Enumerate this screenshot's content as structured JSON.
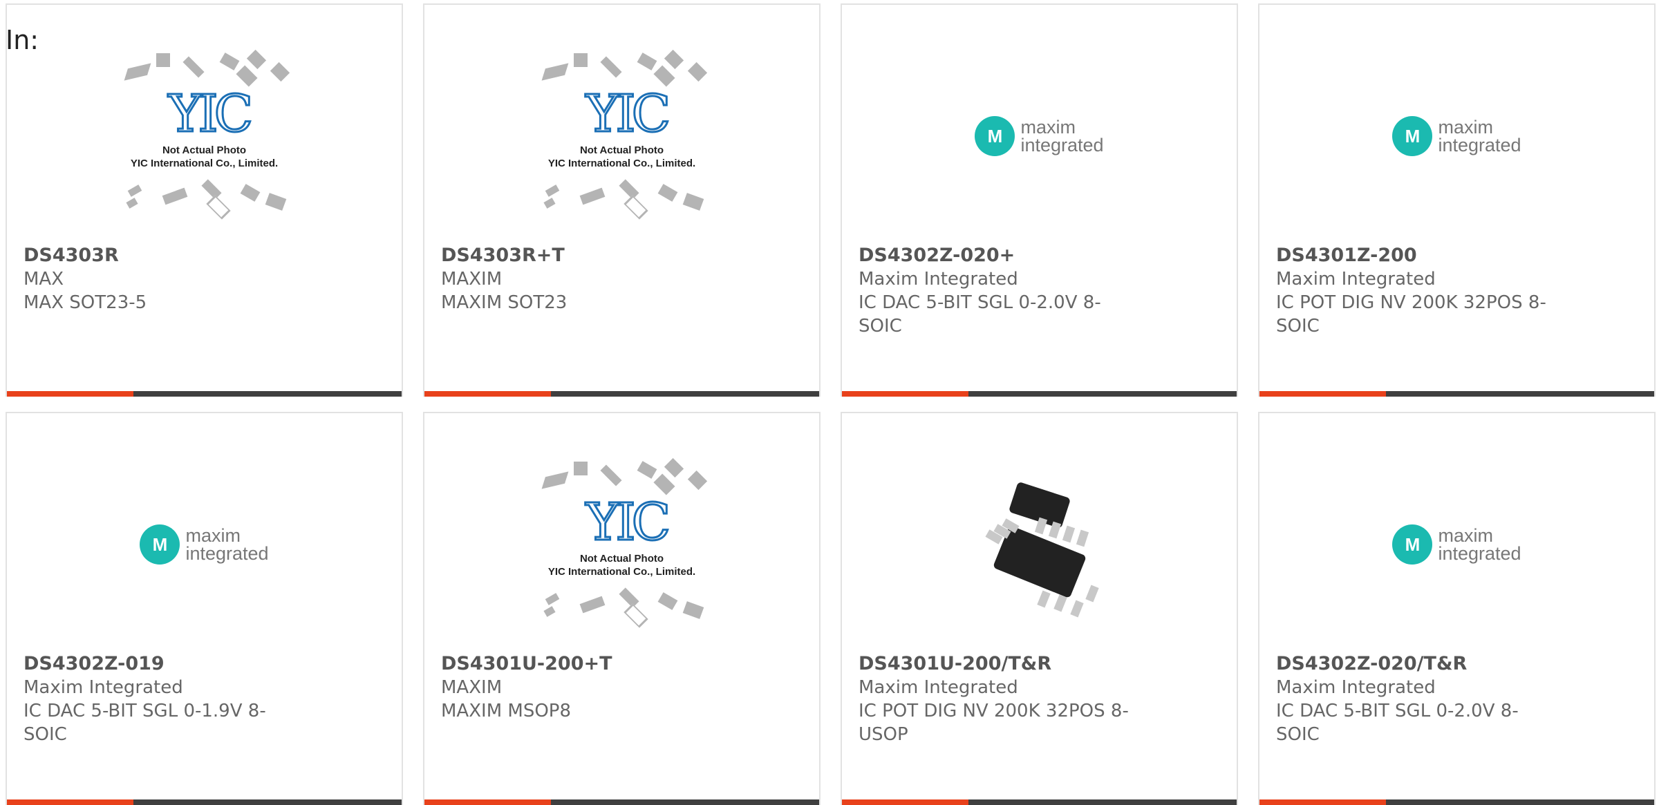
{
  "page": {
    "in_label": "In:"
  },
  "colors": {
    "accent": "#e8411b",
    "bar": "#3f3f3f",
    "maxim_teal": "#1bbab0",
    "yic_blue": "#1b6fb5"
  },
  "placeholder": {
    "logo": "YIC",
    "line1": "Not Actual Photo",
    "line2": "YIC International Co., Limited."
  },
  "maxim_logo": {
    "mark": "M",
    "line1": "maxim",
    "line2": "integrated"
  },
  "products": [
    {
      "part": "DS4303R",
      "mfr": "MAX",
      "desc": "MAX SOT23-5",
      "image": "yic-placeholder"
    },
    {
      "part": "DS4303R+T",
      "mfr": "MAXIM",
      "desc": "MAXIM SOT23",
      "image": "yic-placeholder"
    },
    {
      "part": "DS4302Z-020+",
      "mfr": "Maxim Integrated",
      "desc": "IC DAC 5-BIT SGL 0-2.0V 8-SOIC",
      "image": "maxim-logo"
    },
    {
      "part": "DS4301Z-200",
      "mfr": "Maxim Integrated",
      "desc": "IC POT DIG NV 200K 32POS 8-SOIC",
      "image": "maxim-logo"
    },
    {
      "part": "DS4302Z-019",
      "mfr": "Maxim Integrated",
      "desc": "IC DAC 5-BIT SGL 0-1.9V 8-SOIC",
      "image": "maxim-logo"
    },
    {
      "part": "DS4301U-200+T",
      "mfr": "MAXIM",
      "desc": "MAXIM MSOP8",
      "image": "yic-placeholder"
    },
    {
      "part": "DS4301U-200/T&R",
      "mfr": "Maxim Integrated",
      "desc": "IC POT DIG NV 200K 32POS 8-USOP",
      "image": "ic-photo"
    },
    {
      "part": "DS4302Z-020/T&R",
      "mfr": "Maxim Integrated",
      "desc": "IC DAC 5-BIT SGL 0-2.0V 8-SOIC",
      "image": "maxim-logo"
    }
  ]
}
